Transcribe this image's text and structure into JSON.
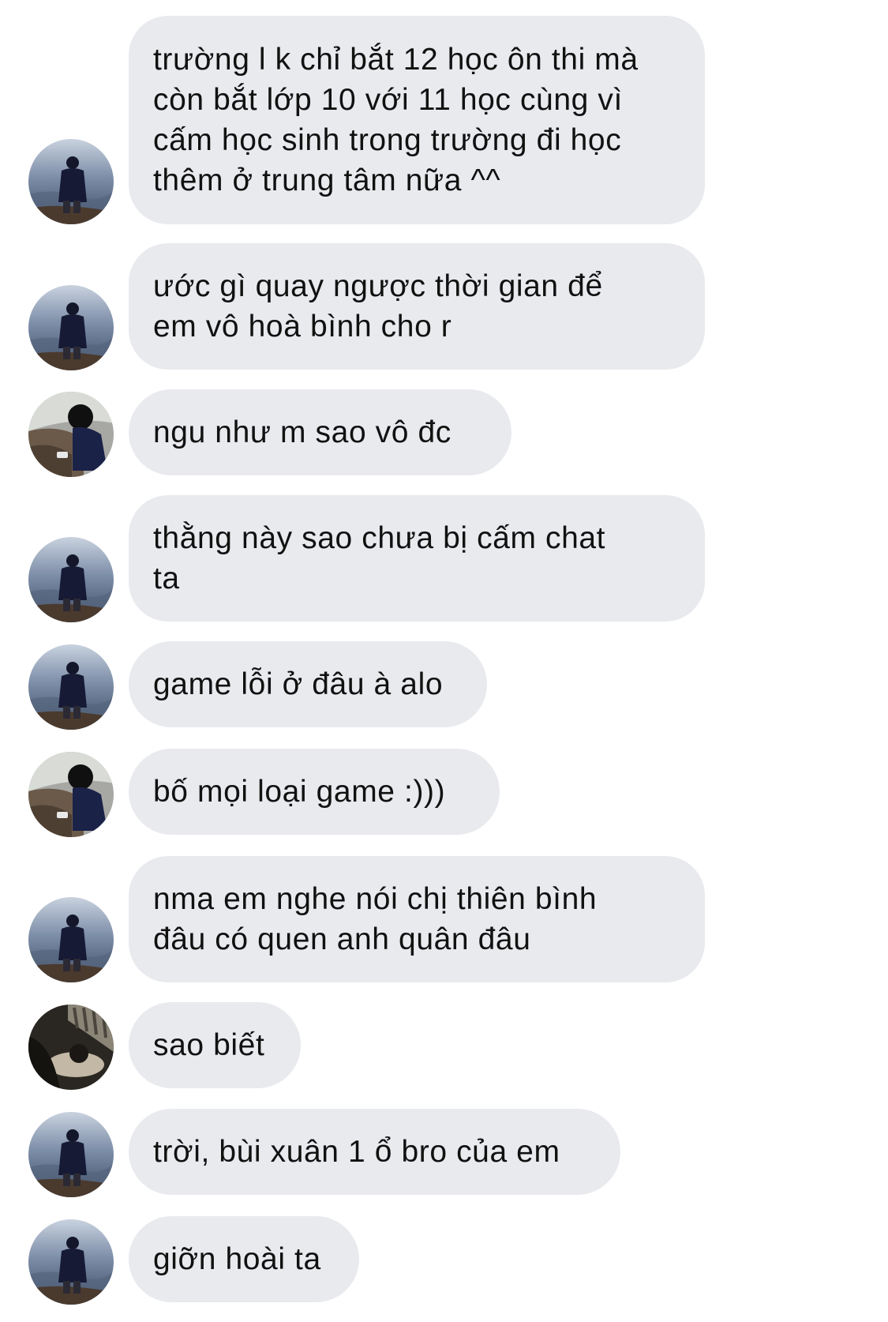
{
  "messages": [
    {
      "text": "trường l k chỉ bắt 12 học ôn thi mà\ncòn bắt lớp 10 với 11 học cùng vì\ncấm học sinh trong trường đi học\nthêm ở trung tâm nữa ^^",
      "avatar": "sea-standing-avatar"
    },
    {
      "text": "ước gì quay ngược thời gian để\nem vô hoà bình cho r",
      "avatar": "sea-standing-avatar"
    },
    {
      "text": "ngu như m sao vô đc",
      "avatar": "rock-sitting-avatar"
    },
    {
      "text": "thằng này sao chưa bị cấm chat\nta",
      "avatar": "sea-standing-avatar"
    },
    {
      "text": "game lỗi ở đâu à alo",
      "avatar": "sea-standing-avatar"
    },
    {
      "text": "bố mọi loại game :)))",
      "avatar": "rock-sitting-avatar"
    },
    {
      "text": "nma em nghe nói chị thiên bình\nđâu có quen anh quân đâu",
      "avatar": "sea-standing-avatar"
    },
    {
      "text": "sao biết",
      "avatar": "dark-sleeping-avatar"
    },
    {
      "text": "trời, bùi xuân 1 ổ bro của em",
      "avatar": "sea-standing-avatar"
    },
    {
      "text": "giỡn hoài ta",
      "avatar": "sea-standing-avatar"
    }
  ],
  "colors": {
    "bubble": "#e9eaee",
    "text": "#111111",
    "background": "#ffffff"
  }
}
